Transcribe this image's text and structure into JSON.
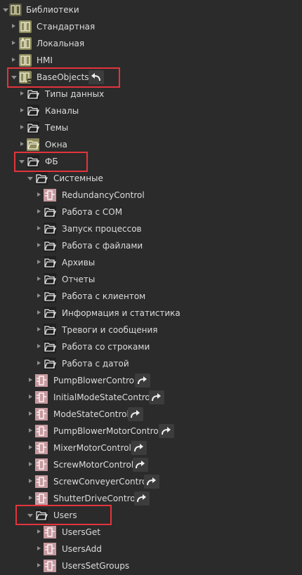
{
  "tree": {
    "root": "Библиотеки",
    "libraries": [
      "Стандартная",
      "Локальная",
      "HMI"
    ],
    "base_objects": "BaseObjects",
    "base_children": [
      "Типы данных",
      "Каналы",
      "Темы",
      "Окна"
    ],
    "fb": "ФБ",
    "system": "Системные",
    "system_items": [
      "RedundancyControl",
      "Работа с COM",
      "Запуск процессов",
      "Работа с файлами",
      "Архивы",
      "Отчеты",
      "Работа с клиентом",
      "Информация и статистика",
      "Тревоги и сообщения",
      "Работа со строками",
      "Работа с датой"
    ],
    "fb_links": [
      "PumpBlowerControl",
      "InitialModeStateControl",
      "ModeStateControl",
      "PumpBlowerMotorControl",
      "MixerMotorControl",
      "ScrewMotorControl",
      "ScrewConveyerControl",
      "ShutterDriveControl"
    ],
    "users": "Users",
    "users_items": [
      "UsersGet",
      "UsersAdd",
      "UsersSetGroups"
    ]
  },
  "colors": {
    "background": "#2b2b2b",
    "highlight": "#e3343c",
    "fb_icon": "#c79aa0",
    "library_icon": "#cfcf8e"
  }
}
